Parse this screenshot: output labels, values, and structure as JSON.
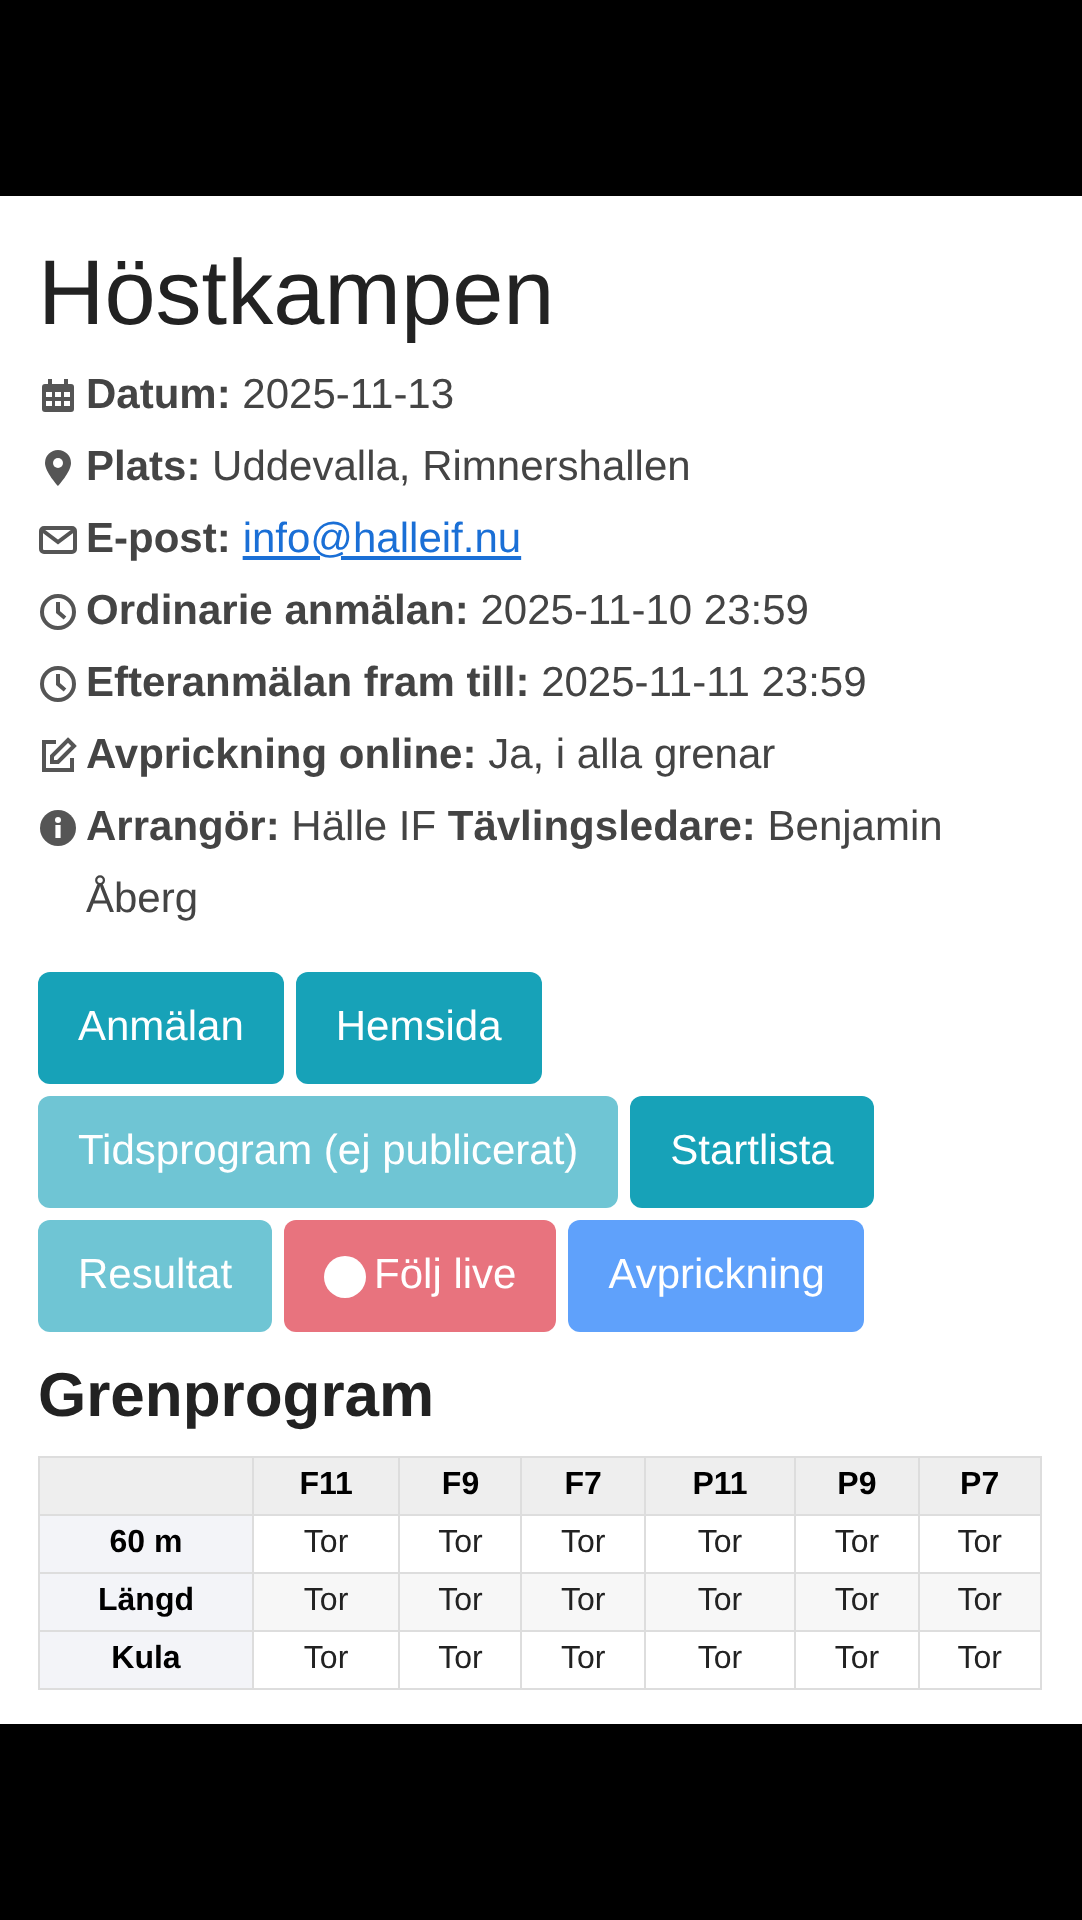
{
  "title": "Höstkampen",
  "info": [
    {
      "kind": "calendar",
      "text": "**Datum:** 2025-11-13"
    },
    {
      "kind": "pin",
      "text": "**Plats:** Uddevalla, Rimnershallen"
    },
    {
      "kind": "mail",
      "text": "**E-post:** ",
      "link": "info@halleif.nu"
    },
    {
      "kind": "clock",
      "text": "**Ordinarie anmälan:** 2025-11-10 23:59"
    },
    {
      "kind": "clock",
      "text": "**Efteranmälan fram till:** 2025-11-11 23:59"
    },
    {
      "kind": "edit",
      "text": "**Avprickning online:** Ja, i alla grenar"
    },
    {
      "kind": "info",
      "text": "**Arrangör:** Hälle IF **Tävlingsledare:** Benjamin Åberg"
    }
  ],
  "buttons": [
    {
      "label": "Anmälan",
      "color": "#17a2b8",
      "indicator": false
    },
    {
      "label": "Hemsida",
      "color": "#17a2b8",
      "indicator": false
    },
    {
      "label": "Tidsprogram (ej publicerat)",
      "color": "#6fc5d4",
      "indicator": false
    },
    {
      "label": "Startlista",
      "color": "#17a2b8",
      "indicator": false
    },
    {
      "label": "Resultat",
      "color": "#6fc5d4",
      "indicator": false
    },
    {
      "label": "Följ live",
      "color": "#e8737e",
      "indicator": true
    },
    {
      "label": "Avprickning",
      "color": "#5fa1fb",
      "indicator": false
    }
  ],
  "section_title": "Grenprogram",
  "table": {
    "columns": [
      "F11",
      "F9",
      "F7",
      "P11",
      "P9",
      "P7"
    ],
    "rows": [
      {
        "label": "60 m",
        "cells": [
          "Tor",
          "Tor",
          "Tor",
          "Tor",
          "Tor",
          "Tor"
        ]
      },
      {
        "label": "Längd",
        "cells": [
          "Tor",
          "Tor",
          "Tor",
          "Tor",
          "Tor",
          "Tor"
        ]
      },
      {
        "label": "Kula",
        "cells": [
          "Tor",
          "Tor",
          "Tor",
          "Tor",
          "Tor",
          "Tor"
        ]
      }
    ]
  }
}
